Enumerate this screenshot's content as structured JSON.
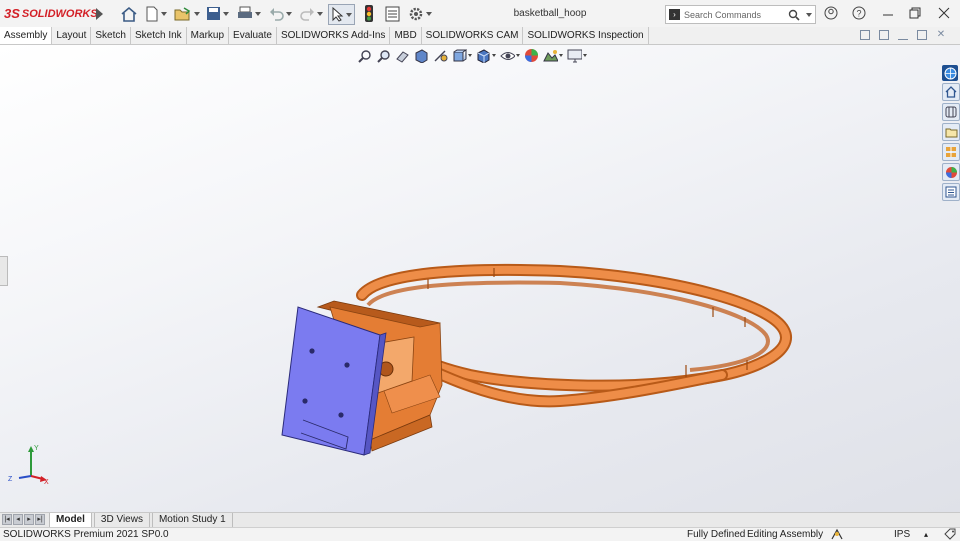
{
  "app": {
    "brand_prefix": "3S",
    "brand_name": "SOLIDWORKS",
    "document_title": "basketball_hoop"
  },
  "search": {
    "placeholder": "Search Commands"
  },
  "window_buttons": [
    "user-icon",
    "help-icon",
    "minimize",
    "restore",
    "close"
  ],
  "command_tabs": [
    {
      "label": "Assembly"
    },
    {
      "label": "Layout"
    },
    {
      "label": "Sketch"
    },
    {
      "label": "Sketch Ink"
    },
    {
      "label": "Markup"
    },
    {
      "label": "Evaluate"
    },
    {
      "label": "SOLIDWORKS Add-Ins"
    },
    {
      "label": "MBD"
    },
    {
      "label": "SOLIDWORKS CAM"
    },
    {
      "label": "SOLIDWORKS Inspection"
    }
  ],
  "triad": {
    "x": "X",
    "y": "Y",
    "z": "Z"
  },
  "bottom_tabs": [
    {
      "label": "Model",
      "active": true
    },
    {
      "label": "3D Views",
      "active": false
    },
    {
      "label": "Motion Study 1",
      "active": false
    }
  ],
  "status": {
    "version": "SOLIDWORKS Premium 2021 SP0.0",
    "definition": "Fully Defined",
    "mode": "Editing Assembly",
    "units": "IPS"
  },
  "colors": {
    "rim": "#e7853f",
    "backplate": "#7b7bf0",
    "bracket": "#e47d34",
    "brand_red": "#d32027"
  }
}
